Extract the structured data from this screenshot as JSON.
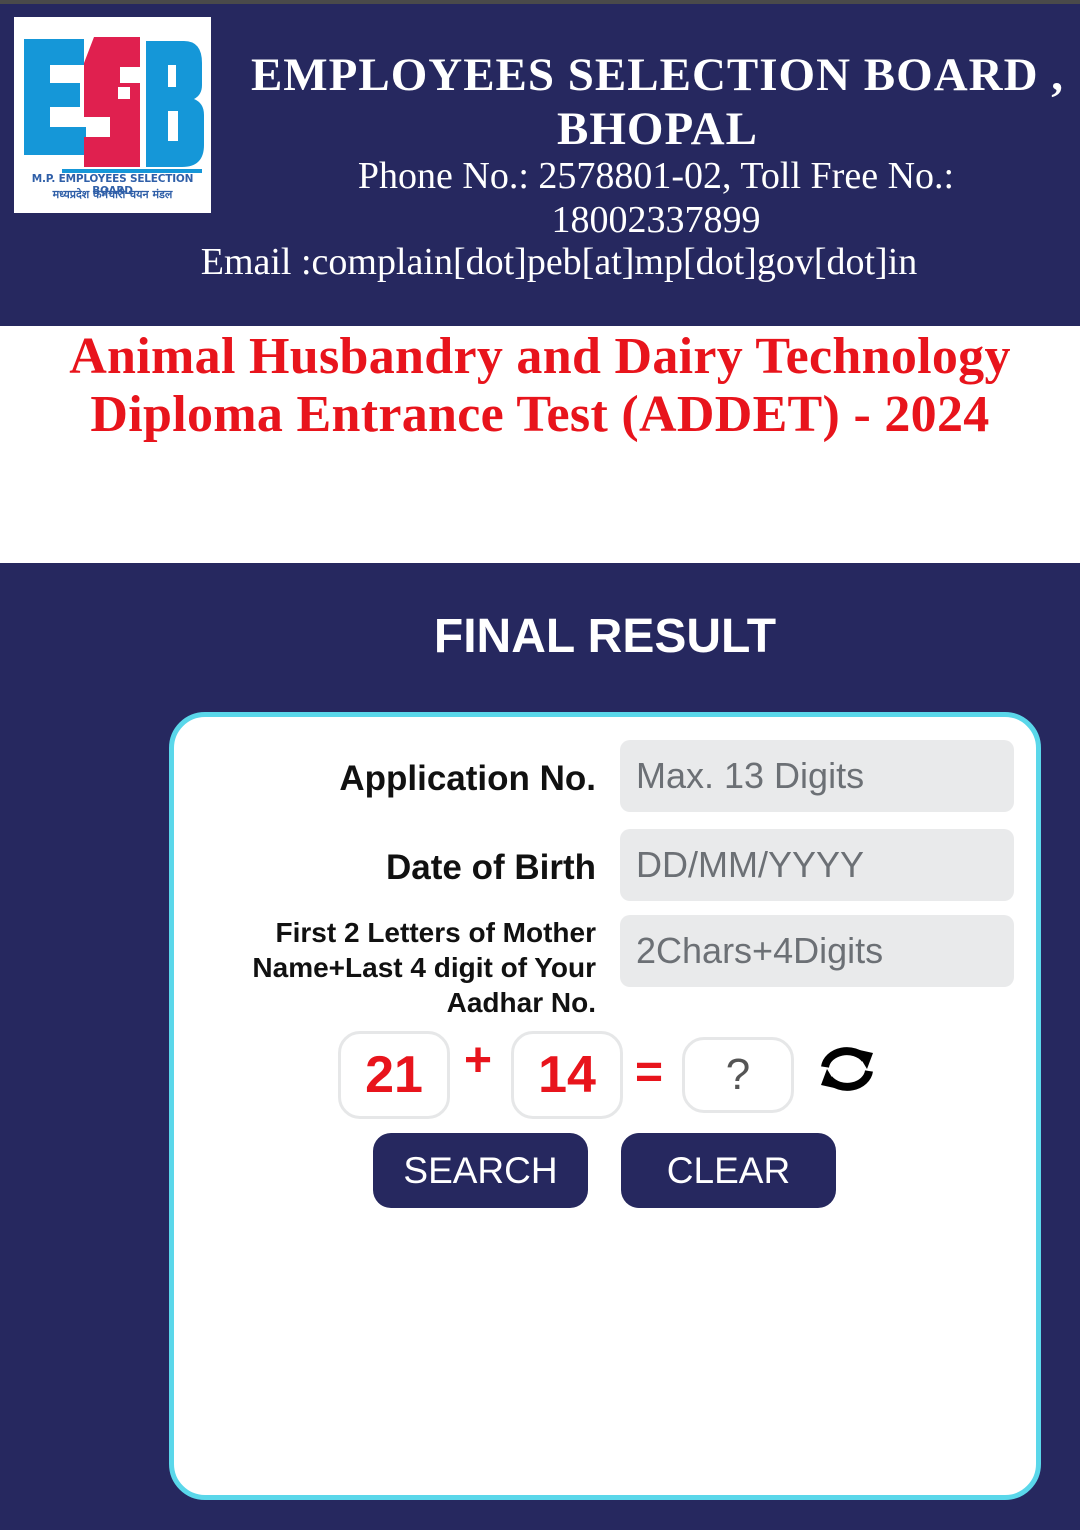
{
  "header": {
    "logo": {
      "letters": "ESB",
      "caption_en": "M.P. EMPLOYEES SELECTION BOARD",
      "caption_hi": "मध्यप्रदेश कर्मचारी चयन मंडल"
    },
    "org_name_line1": "EMPLOYEES SELECTION BOARD ,",
    "org_name_line2": "BHOPAL",
    "phone_line": "Phone No.: 2578801-02, Toll Free No.:",
    "toll_free": "18002337899",
    "email": "Email :complain[dot]peb[at]mp[dot]gov[dot]in"
  },
  "exam": {
    "title_line1": "Animal Husbandry and Dairy Technology",
    "title_line2": "Diploma Entrance Test (ADDET) - 2024"
  },
  "result": {
    "title": "FINAL RESULT"
  },
  "form": {
    "application": {
      "label": "Application No.",
      "value": "",
      "placeholder": "Max. 13 Digits"
    },
    "dob": {
      "label": "Date of Birth",
      "value": "",
      "placeholder": "DD/MM/YYYY"
    },
    "mother_aadhar": {
      "label_line1": "First 2 Letters of Mother",
      "label_line2": "Name+Last 4 digit of Your",
      "label_line3": "Aadhar No.",
      "value": "",
      "placeholder": "2Chars+4Digits"
    },
    "captcha": {
      "a": "21",
      "op": "+",
      "b": "14",
      "eq": "=",
      "answer_placeholder": "?",
      "refresh_icon": "refresh-icon"
    },
    "search_label": "SEARCH",
    "clear_label": "CLEAR"
  },
  "colors": {
    "navy": "#26285f",
    "red": "#e8141c",
    "card_border": "#5ad7ea",
    "logo_blue": "#1597d8",
    "logo_pink": "#e0204f"
  }
}
